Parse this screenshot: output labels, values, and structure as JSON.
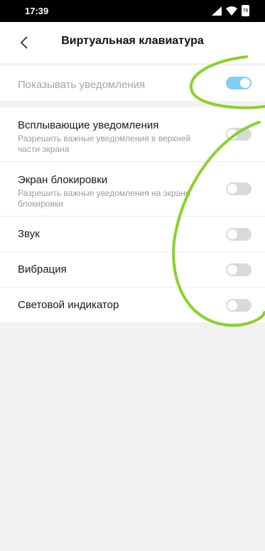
{
  "status_bar": {
    "time": "17:39",
    "battery_level": "76"
  },
  "header": {
    "title": "Виртуальная клавиатура"
  },
  "master_toggle": {
    "label": "Показывать уведомления",
    "enabled": true
  },
  "settings": [
    {
      "title": "Всплывающие уведомления",
      "subtitle": "Разрешить важные уведомления в верхней части экрана",
      "enabled": false
    },
    {
      "title": "Экран блокировки",
      "subtitle": "Разрешить важные уведомления на экране блокировки",
      "enabled": false
    },
    {
      "title": "Звук",
      "enabled": false
    },
    {
      "title": "Вибрация",
      "enabled": false
    },
    {
      "title": "Световой индикатор",
      "enabled": false
    }
  ],
  "colors": {
    "toggle_on": "#6cc7f5",
    "toggle_off": "#d9d9d9",
    "annotation": "#8ad12a"
  }
}
